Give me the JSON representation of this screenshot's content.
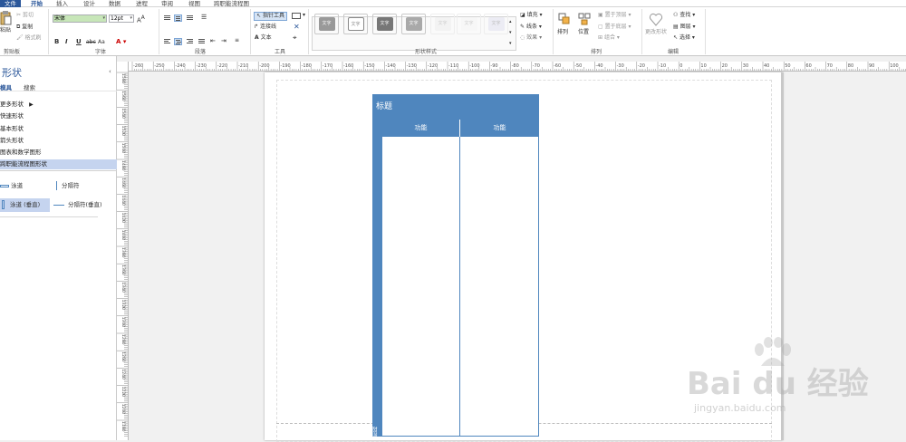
{
  "tabs": [
    {
      "label": "文件",
      "kind": "file"
    },
    {
      "label": "开始",
      "kind": "active"
    },
    {
      "label": "插入",
      "kind": ""
    },
    {
      "label": "设计",
      "kind": ""
    },
    {
      "label": "数据",
      "kind": ""
    },
    {
      "label": "进程",
      "kind": ""
    },
    {
      "label": "审阅",
      "kind": ""
    },
    {
      "label": "视图",
      "kind": ""
    },
    {
      "label": "跨职能流程图",
      "kind": ""
    }
  ],
  "ribbon": {
    "clipboard": {
      "paste": "粘贴",
      "cut": "剪切",
      "copy": "复制",
      "format_painter": "格式刷",
      "group": "剪贴板"
    },
    "font": {
      "family": "宋体",
      "size": "12pt",
      "bold": "B",
      "italic": "I",
      "underline": "U",
      "strike": "abc",
      "case": "Aa",
      "group": "字体"
    },
    "paragraph": {
      "group": "段落"
    },
    "tools": {
      "pointer": "指针工具",
      "connector": "连接线",
      "text": "文本",
      "group": "工具"
    },
    "shape_styles": {
      "swatch_text": "文字",
      "fill": "填充",
      "line": "线条",
      "effects": "效果",
      "group": "形状样式"
    },
    "arrange": {
      "arrange": "排列",
      "position": "位置",
      "bring_front": "置于顶层",
      "send_back": "置于底层",
      "group_btn": "组合",
      "group": "排列"
    },
    "editing": {
      "change_shape": "更改形状",
      "find": "查找",
      "layers": "图层",
      "select": "选择",
      "group": "编辑"
    }
  },
  "shapes_panel": {
    "title": "形状",
    "tab_more": "模具",
    "tab_search": "搜索",
    "items": [
      "更多形状",
      "快速形状",
      "基本形状",
      "箭头形状",
      "图表和数学图形",
      "跨职能流程图形状"
    ],
    "selected_index": 5,
    "masters": [
      "泳道",
      "分隔符",
      "泳道 (垂直)",
      "分隔符(垂直)"
    ]
  },
  "rulers": {
    "h_ticks": [
      "-260",
      "-250",
      "-240",
      "-230",
      "-220",
      "-210",
      "-200",
      "-190",
      "-180",
      "-170",
      "-160",
      "-150",
      "-140",
      "-130",
      "-120",
      "-110",
      "-100",
      "-90",
      "-80",
      "-70",
      "-60",
      "-50",
      "-40",
      "-30",
      "-20",
      "-10",
      "0",
      "10",
      "20",
      "30",
      "40",
      "50",
      "60",
      "70",
      "80",
      "90",
      "100"
    ],
    "v_ticks": [
      "1580",
      "1560",
      "1540",
      "1520",
      "1500",
      "1480",
      "1460",
      "1440",
      "1420",
      "1400",
      "1380",
      "1360",
      "1340",
      "1320",
      "1300",
      "1280",
      "1260",
      "1240",
      "1220",
      "1200",
      "1180"
    ]
  },
  "diagram": {
    "title": "标题",
    "lane1": "功能",
    "lane2": "功能",
    "stage": "阶段"
  },
  "watermark": {
    "brand": "Bai du 经验",
    "url": "jingyan.baidu.com"
  },
  "colors": {
    "accent": "#2b579a",
    "lane": "#4f86be",
    "selected": "#c5d4ef"
  }
}
